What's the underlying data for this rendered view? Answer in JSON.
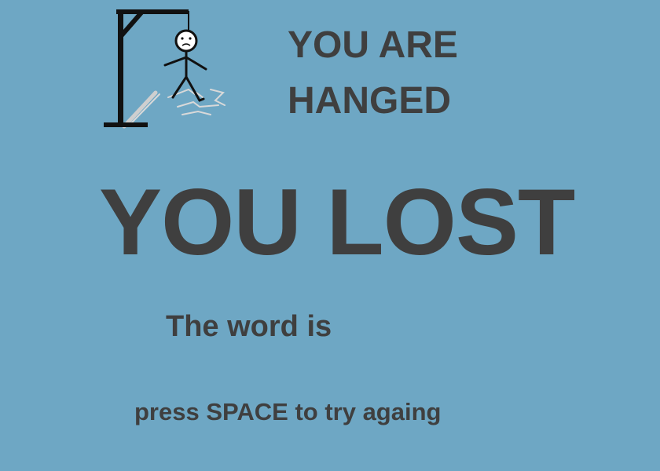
{
  "game": {
    "status_line_1": "YOU ARE",
    "status_line_2": "HANGED",
    "result": "YOU LOST",
    "word_prompt": "The word is",
    "hint": "press SPACE to try againg"
  },
  "icons": {
    "hangman": "hanged-stickman-icon"
  },
  "colors": {
    "background": "#6ea7c4",
    "text": "#3f3f3f",
    "gallows": "#111111"
  }
}
